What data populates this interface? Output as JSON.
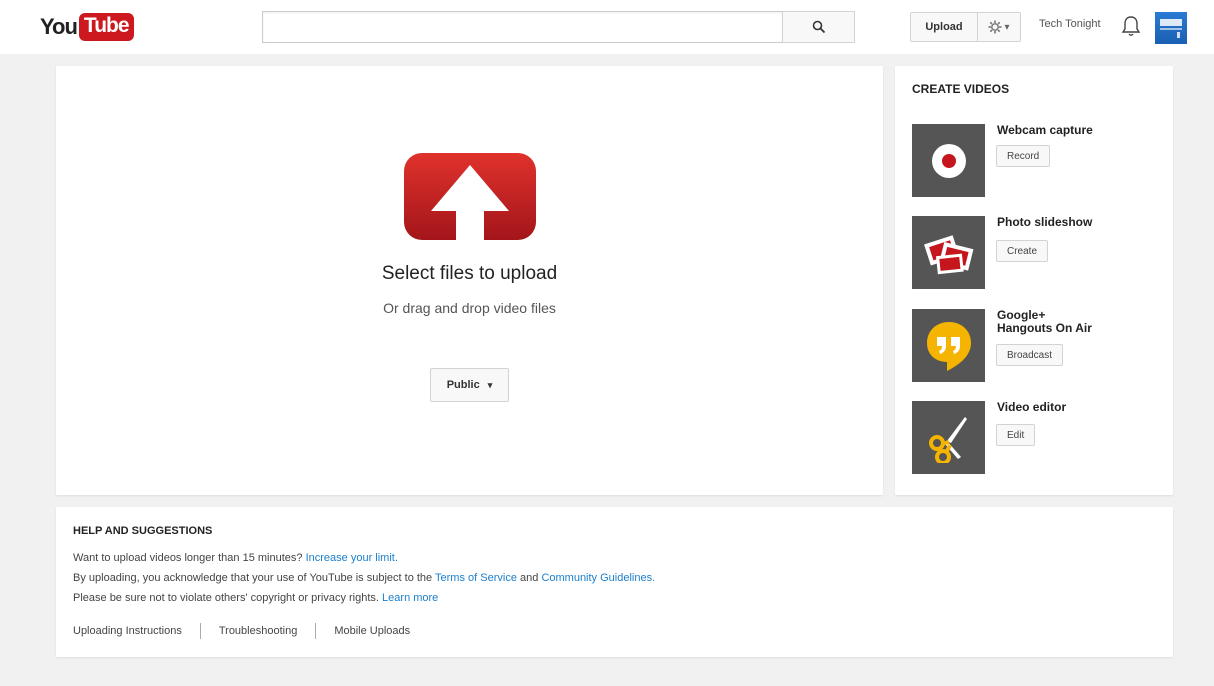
{
  "header": {
    "logo_you": "You",
    "logo_tube": "Tube",
    "search_placeholder": "",
    "upload_label": "Upload",
    "channel_name": "Tech Tonight"
  },
  "upload": {
    "title": "Select files to upload",
    "subtitle": "Or drag and drop video files",
    "privacy_value": "Public"
  },
  "create": {
    "title": "CREATE VIDEOS",
    "tools": [
      {
        "name": "Webcam capture",
        "button": "Record",
        "icon": "record-icon"
      },
      {
        "name": "Photo slideshow",
        "button": "Create",
        "icon": "photos-icon"
      },
      {
        "name": "Google+ Hangouts On Air",
        "name_line1": "Google+",
        "name_line2": "Hangouts On Air",
        "button": "Broadcast",
        "icon": "hangouts-icon"
      },
      {
        "name": "Video editor",
        "button": "Edit",
        "icon": "scissors-icon"
      }
    ]
  },
  "help": {
    "title": "HELP AND SUGGESTIONS",
    "line1_text": "Want to upload videos longer than 15 minutes?",
    "line1_link": "Increase your limit.",
    "line2_text_a": "By uploading, you acknowledge that your use of YouTube is subject to the",
    "line2_link_a": "Terms of Service",
    "line2_text_b": "and",
    "line2_link_b": "Community Guidelines.",
    "line3_text": "Please be sure not to violate others' copyright or privacy rights.",
    "line3_link": "Learn more",
    "links": [
      "Uploading Instructions",
      "Troubleshooting",
      "Mobile Uploads"
    ]
  },
  "colors": {
    "brand_red": "#cc181e",
    "link_blue": "#1b7fcc",
    "background": "#f1f1f1"
  }
}
